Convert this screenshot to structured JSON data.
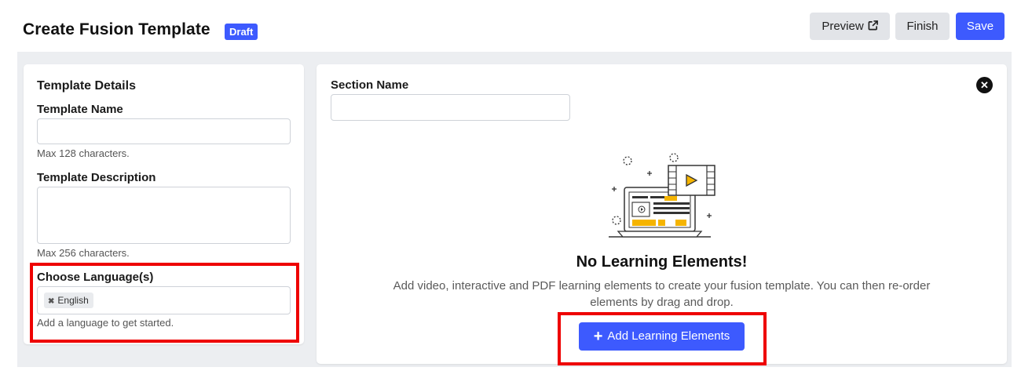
{
  "header": {
    "title": "Create Fusion Template",
    "badge": "Draft",
    "preview_label": "Preview",
    "finish_label": "Finish",
    "save_label": "Save"
  },
  "details": {
    "heading": "Template Details",
    "name_label": "Template Name",
    "name_value": "",
    "name_help": "Max 128 characters.",
    "description_label": "Template Description",
    "description_value": "",
    "description_help": "Max 256 characters.",
    "language_label": "Choose Language(s)",
    "languages": [
      "English"
    ],
    "language_help": "Add a language to get started."
  },
  "section": {
    "name_label": "Section Name",
    "name_value": "",
    "empty_title": "No Learning Elements!",
    "empty_description": "Add video, interactive and PDF learning elements to create your fusion template. You can then re-order elements by drag and drop.",
    "add_button_label": "Add Learning Elements"
  },
  "icons": {
    "preview": "external-link-icon",
    "close": "close-icon",
    "remove_tag": "remove-tag-icon",
    "add": "plus-icon"
  },
  "colors": {
    "primary": "#3d5afe",
    "highlight": "#ee0000",
    "accent": "#f5b400"
  }
}
